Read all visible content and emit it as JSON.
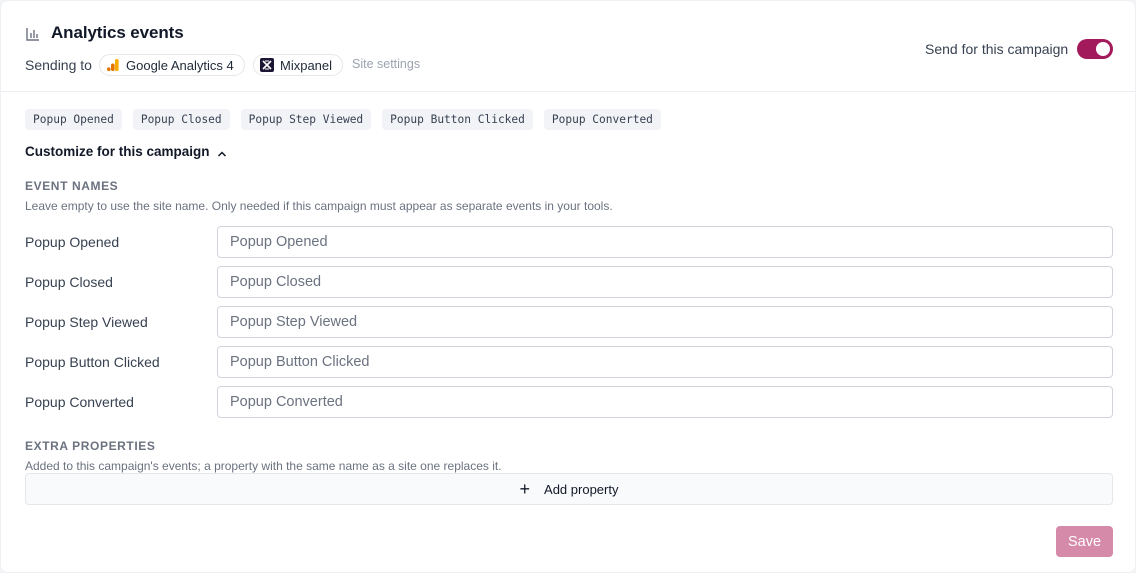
{
  "header": {
    "title": "Analytics events",
    "sending_label": "Sending to",
    "destinations": [
      {
        "name": "Google Analytics 4",
        "icon": "google-analytics-logo"
      },
      {
        "name": "Mixpanel",
        "icon": "mixpanel-logo"
      }
    ],
    "site_settings_link": "Site settings",
    "send_toggle_label": "Send for this campaign",
    "send_toggle_on": true
  },
  "events": [
    "Popup Opened",
    "Popup Closed",
    "Popup Step Viewed",
    "Popup Button Clicked",
    "Popup Converted"
  ],
  "customize": {
    "label": "Customize for this campaign",
    "expanded": true
  },
  "event_names": {
    "title": "EVENT NAMES",
    "description": "Leave empty to use the site name. Only needed if this campaign must appear as separate events in your tools.",
    "rows": [
      {
        "label": "Popup Opened",
        "placeholder": "Popup Opened",
        "value": ""
      },
      {
        "label": "Popup Closed",
        "placeholder": "Popup Closed",
        "value": ""
      },
      {
        "label": "Popup Step Viewed",
        "placeholder": "Popup Step Viewed",
        "value": ""
      },
      {
        "label": "Popup Button Clicked",
        "placeholder": "Popup Button Clicked",
        "value": ""
      },
      {
        "label": "Popup Converted",
        "placeholder": "Popup Converted",
        "value": ""
      }
    ]
  },
  "extra_properties": {
    "title": "EXTRA PROPERTIES",
    "description": "Added to this campaign's events; a property with the same name as a site one replaces it.",
    "add_button_label": "Add property"
  },
  "save_label": "Save",
  "colors": {
    "accent": "#a21a5b",
    "save_disabled": "#d68aa9",
    "ga_orange": "#f9ab00",
    "ga_dark_orange": "#e37400",
    "mixpanel_dark": "#1c1533"
  }
}
